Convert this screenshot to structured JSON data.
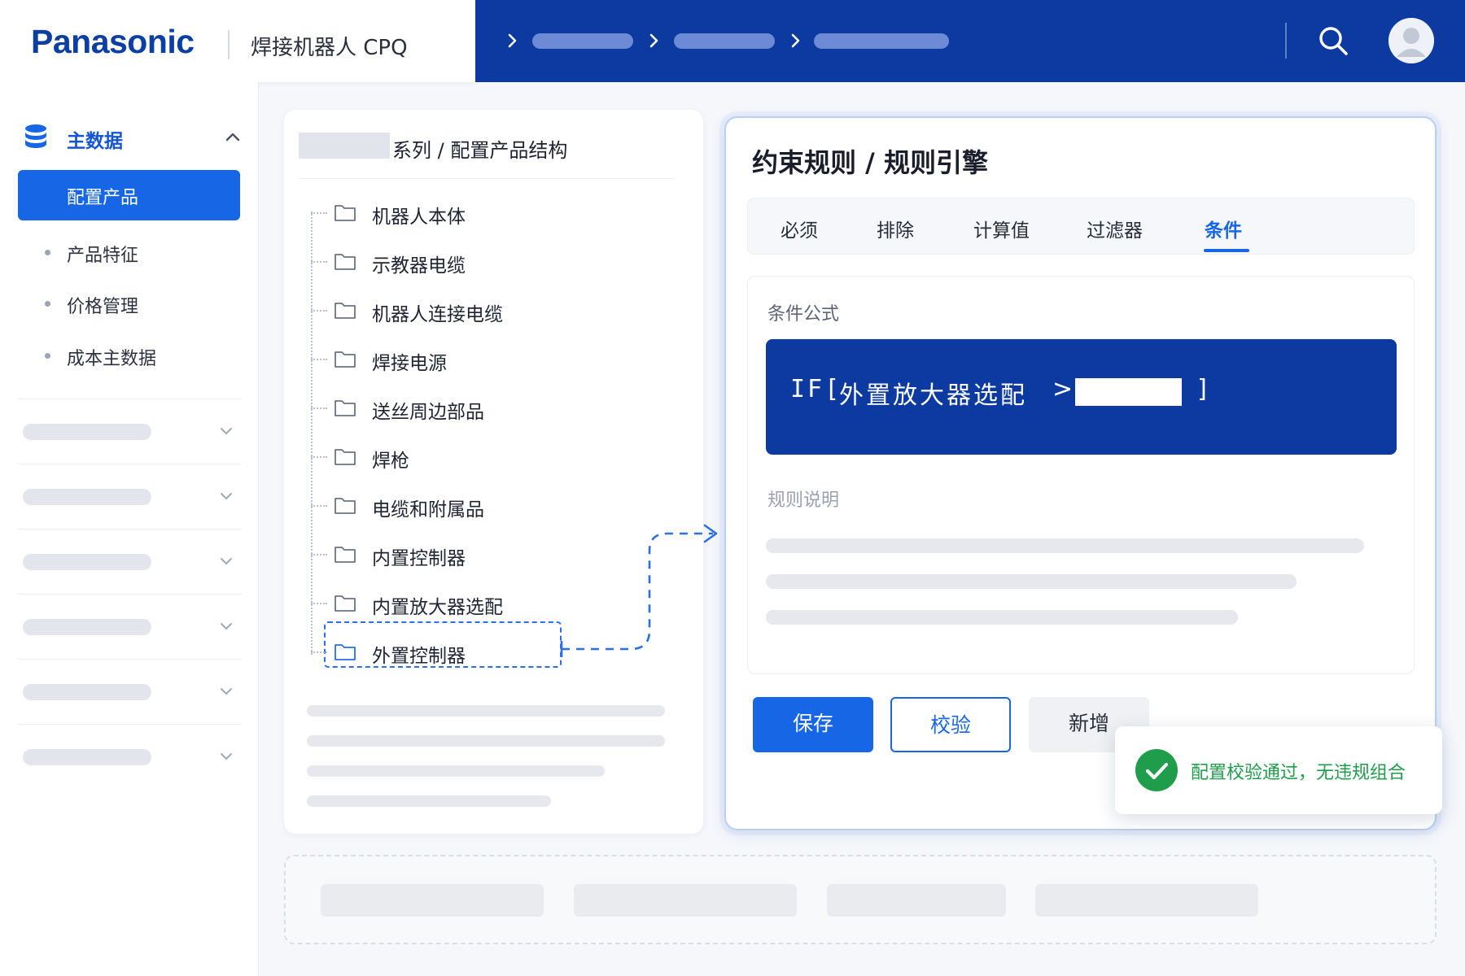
{
  "header": {
    "logo": "Panasonic",
    "app_title": "焊接机器人 CPQ"
  },
  "sidebar": {
    "group_label": "主数据",
    "active_item": "配置产品",
    "items": [
      {
        "label": "产品特征"
      },
      {
        "label": "价格管理"
      },
      {
        "label": "成本主数据"
      }
    ]
  },
  "tree": {
    "title": "系列 / 配置产品结构",
    "nodes": [
      {
        "label": "机器人本体"
      },
      {
        "label": "示教器电缆"
      },
      {
        "label": "机器人连接电缆"
      },
      {
        "label": "焊接电源"
      },
      {
        "label": "送丝周边部品"
      },
      {
        "label": "焊枪"
      },
      {
        "label": "电缆和附属品"
      },
      {
        "label": "内置控制器"
      },
      {
        "label": "内置放大器选配"
      },
      {
        "label": "外置控制器"
      }
    ],
    "selected_index": 9
  },
  "rule": {
    "title": "约束规则 / 规则引擎",
    "tabs": [
      {
        "label": "必须"
      },
      {
        "label": "排除"
      },
      {
        "label": "计算值"
      },
      {
        "label": "过滤器"
      },
      {
        "label": "条件"
      }
    ],
    "active_tab": 4,
    "condition_label": "条件公式",
    "formula": {
      "keyword": "IF[",
      "operand": "外置放大器选配",
      "operator": ">",
      "closing": "]"
    },
    "description_label": "规则说明",
    "buttons": {
      "save": "保存",
      "verify": "校验",
      "add": "新增"
    }
  },
  "toast": {
    "message": "配置校验通过，无违规组合"
  },
  "colors": {
    "brand": "#0c3aa1",
    "accent": "#1766e6",
    "success": "#1f9d4a"
  }
}
